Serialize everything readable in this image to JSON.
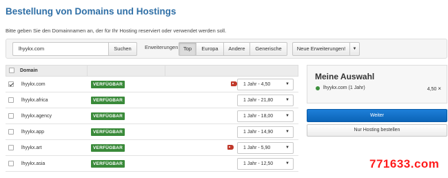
{
  "header": {
    "title": "Bestellung von Domains und Hostings",
    "hint": "Bitte geben Sie den Domainnamen an, der für Ihr Hosting reserviert oder verwendet werden soll."
  },
  "search": {
    "value": "lhyykx.com",
    "button": "Suchen"
  },
  "extensions": {
    "label": "Erweiterungen:",
    "tabs": [
      "Top",
      "Europa",
      "Andere",
      "Generische"
    ],
    "active": "Top",
    "new_button": "Neue Erweiterungen!",
    "dropdown_icon": "caret-down-icon"
  },
  "table": {
    "column_domain": "Domain",
    "rows": [
      {
        "domain": "lhyykx.com",
        "status": "VERFÜGBAR",
        "price": "1 Jahr - 4,50",
        "checked": true,
        "promo": true
      },
      {
        "domain": "lhyykx.africa",
        "status": "VERFÜGBAR",
        "price": "1 Jahr - 21,80",
        "checked": false,
        "promo": false
      },
      {
        "domain": "lhyykx.agency",
        "status": "VERFÜGBAR",
        "price": "1 Jahr - 18,00",
        "checked": false,
        "promo": false
      },
      {
        "domain": "lhyykx.app",
        "status": "VERFÜGBAR",
        "price": "1 Jahr - 14,90",
        "checked": false,
        "promo": false
      },
      {
        "domain": "lhyykx.art",
        "status": "VERFÜGBAR",
        "price": "1 Jahr - 5,90",
        "checked": false,
        "promo": true
      },
      {
        "domain": "lhyykx.asia",
        "status": "VERFÜGBAR",
        "price": "1 Jahr - 12,50",
        "checked": false,
        "promo": false
      }
    ]
  },
  "selection": {
    "title": "Meine Auswahl",
    "item": "lhyykx.com (1 Jahr)",
    "price": "4,50",
    "remove": "×"
  },
  "actions": {
    "continue": "Weiter",
    "hosting_only": "Nur Hosting bestellen"
  },
  "watermark": "771633.com",
  "colors": {
    "title": "#2f6fa6",
    "badge": "#3a8a3a",
    "primary": "#0b64b8",
    "tag": "#c0392b",
    "watermark": "#ff1a1a"
  }
}
